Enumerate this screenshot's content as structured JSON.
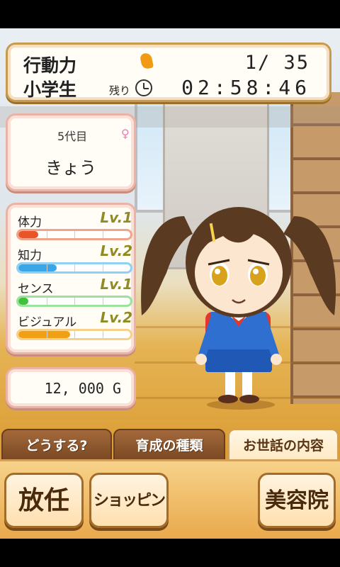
{
  "header": {
    "action_points_label": "行動力",
    "action_points_value": "1/ 35",
    "grade_label": "小学生",
    "remaining_label": "残り",
    "timer": "02:58:46"
  },
  "profile": {
    "generation": "5代目",
    "gender_symbol": "♀",
    "name": "きょう"
  },
  "stats": [
    {
      "label": "体力",
      "level": "Lv.1",
      "progress": 0.18,
      "color": "#e8552b",
      "border": "#f0a58a"
    },
    {
      "label": "知力",
      "level": "Lv.2",
      "progress": 0.34,
      "color": "#3aa6e8",
      "border": "#8fd0f3"
    },
    {
      "label": "センス",
      "level": "Lv.1",
      "progress": 0.09,
      "color": "#3fc23a",
      "border": "#9be39a"
    },
    {
      "label": "ビジュアル",
      "level": "Lv.2",
      "progress": 0.46,
      "color": "#f2a013",
      "border": "#f7d08a"
    }
  ],
  "money": "12, 000 G",
  "tabs": [
    "どうする?",
    "育成の種類",
    "お世話の内容"
  ],
  "commands": [
    "放任",
    "ショッピング",
    "美容院"
  ],
  "colors": {
    "panel_border": "#c79b4e",
    "tab_dark": "#7a4823",
    "command_bg": "#ffe0b0"
  }
}
